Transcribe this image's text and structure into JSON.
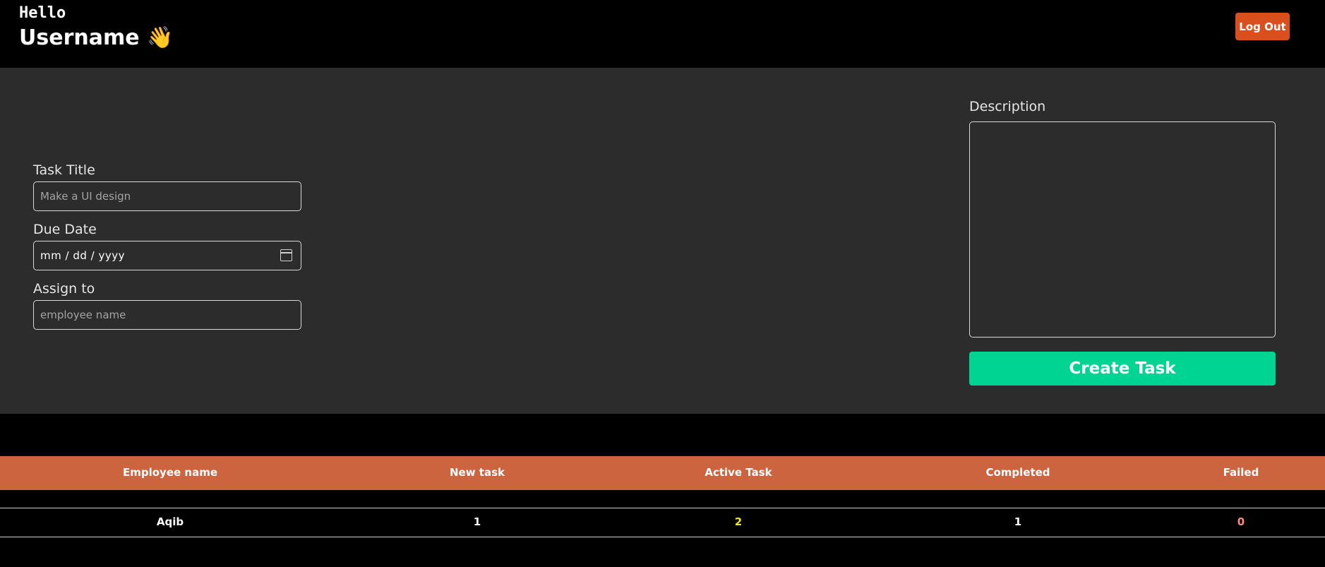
{
  "header": {
    "greeting": "Hello",
    "username": "Username 👋",
    "logout_label": "Log Out"
  },
  "form": {
    "task_title_label": "Task Title",
    "task_title_placeholder": "Make a UI design",
    "due_date_label": "Due Date",
    "due_date_value": "mm / dd / yyyy",
    "assign_label": "Assign to",
    "assign_placeholder": "employee name",
    "description_label": "Description",
    "description_value": "",
    "create_label": "Create Task"
  },
  "table": {
    "columns": [
      "Employee name",
      "New task",
      "Active Task",
      "Completed",
      "Failed"
    ],
    "rows": [
      {
        "name": "Aqib",
        "new_task": "1",
        "active_task": "2",
        "completed": "1",
        "failed": "0"
      }
    ],
    "colors": {
      "header_bg": "#cd6440",
      "active_color": "#f2e81a",
      "failed_color": "#ff8b7a"
    }
  },
  "colors": {
    "logout_bg": "#d9501e",
    "create_bg": "#00d492",
    "panel_bg": "#2c2c2c"
  }
}
